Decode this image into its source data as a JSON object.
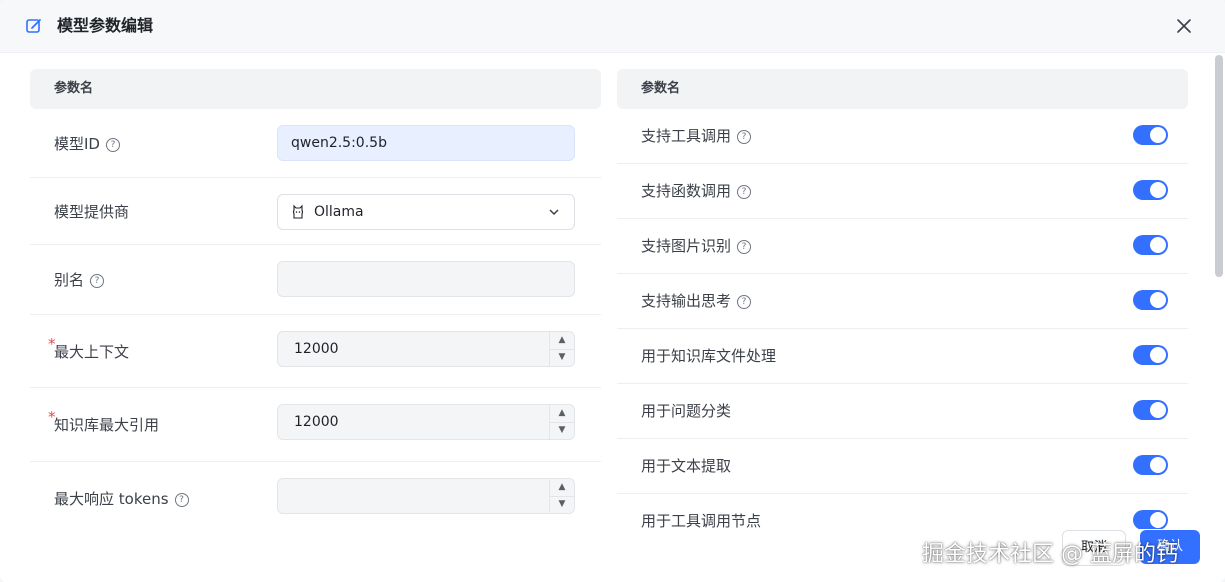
{
  "dialog": {
    "title": "模型参数编辑"
  },
  "left_panel": {
    "header": "参数名",
    "rows": [
      {
        "label": "模型ID",
        "help": "?",
        "value": "qwen2.5:0.5b"
      },
      {
        "label": "模型提供商",
        "value": "Ollama"
      },
      {
        "label": "别名",
        "help": "?",
        "value": ""
      },
      {
        "required": "*",
        "label": "最大上下文",
        "value": "12000"
      },
      {
        "required": "*",
        "label": "知识库最大引用",
        "value": "12000"
      },
      {
        "label": "最大响应 tokens",
        "help": "?",
        "value": ""
      }
    ]
  },
  "right_panel": {
    "header": "参数名",
    "toggles": [
      {
        "label": "支持工具调用",
        "help": "?",
        "on": true
      },
      {
        "label": "支持函数调用",
        "help": "?",
        "on": true
      },
      {
        "label": "支持图片识别",
        "help": "?",
        "on": true
      },
      {
        "label": "支持输出思考",
        "help": "?",
        "on": true
      },
      {
        "label": "用于知识库文件处理",
        "on": true
      },
      {
        "label": "用于问题分类",
        "on": true
      },
      {
        "label": "用于文本提取",
        "on": true
      },
      {
        "label": "用于工具调用节点",
        "on": true
      }
    ]
  },
  "footer": {
    "cancel_label": "取消",
    "ok_label": "确认"
  },
  "watermark": "掘金技术社区 @ 蓝屏的钙",
  "colors": {
    "accent": "#3370ff",
    "required": "#e34d4d"
  }
}
